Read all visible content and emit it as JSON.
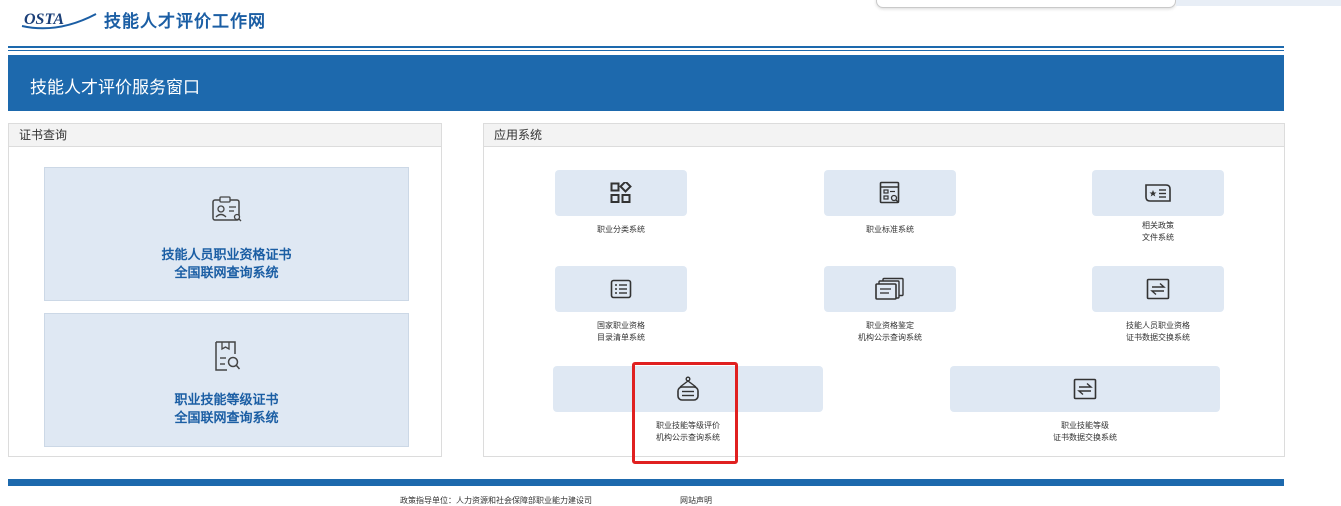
{
  "header": {
    "logo_text": "OSTA",
    "site_title": "技能人才评价工作网"
  },
  "banner": {
    "title": "技能人才评价服务窗口"
  },
  "cert_panel": {
    "title": "证书查询",
    "cards": [
      {
        "line1": "技能人员职业资格证书",
        "line2": "全国联网查询系统",
        "icon": "id-card-search-icon"
      },
      {
        "line1": "职业技能等级证书",
        "line2": "全国联网查询系统",
        "icon": "document-search-icon"
      }
    ]
  },
  "apps_panel": {
    "title": "应用系统",
    "items": [
      {
        "line1": "职业分类系统",
        "line2": "",
        "icon": "category-grid-icon"
      },
      {
        "line1": "职业标准系统",
        "line2": "",
        "icon": "standard-search-icon"
      },
      {
        "line1": "相关政策",
        "line2": "文件系统",
        "icon": "policy-book-icon"
      },
      {
        "line1": "国家职业资格",
        "line2": "目录清单系统",
        "icon": "list-icon"
      },
      {
        "line1": "职业资格鉴定",
        "line2": "机构公示查询系统",
        "icon": "documents-icon"
      },
      {
        "line1": "技能人员职业资格",
        "line2": "证书数据交换系统",
        "icon": "exchange-icon"
      },
      {
        "line1": "职业技能等级评价",
        "line2": "机构公示查询系统",
        "icon": "badge-icon"
      },
      {
        "line1": "职业技能等级",
        "line2": "证书数据交换系统",
        "icon": "exchange-icon"
      }
    ]
  },
  "footer": {
    "org": "政策指导单位：人力资源和社会保障部职业能力建设司",
    "statement": "网站声明"
  },
  "colors": {
    "brand_blue": "#1d69ad",
    "tile_bg": "#dfe8f3",
    "highlight": "#e02020"
  }
}
